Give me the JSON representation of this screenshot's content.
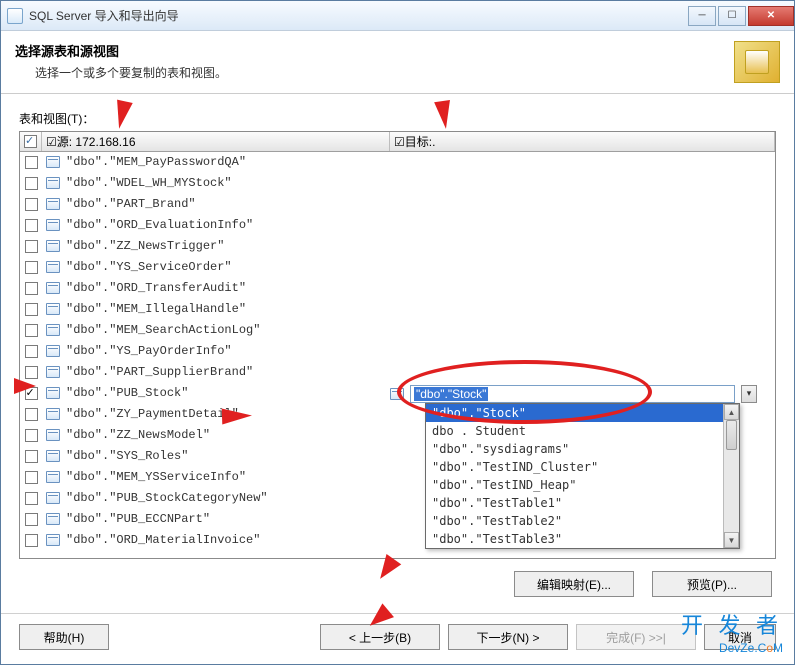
{
  "window": {
    "title": "SQL Server 导入和导出向导"
  },
  "header": {
    "title": "选择源表和源视图",
    "subtitle": "选择一个或多个要复制的表和视图。"
  },
  "label_tables": "表和视图(T)：",
  "columns": {
    "source_label": "源: 172.168.16",
    "dest_label": "目标:."
  },
  "rows": [
    {
      "text": "\"dbo\".\"MEM_PayPasswordQA\"",
      "checked": false
    },
    {
      "text": "\"dbo\".\"WDEL_WH_MYStock\"",
      "checked": false
    },
    {
      "text": "\"dbo\".\"PART_Brand\"",
      "checked": false
    },
    {
      "text": "\"dbo\".\"ORD_EvaluationInfo\"",
      "checked": false
    },
    {
      "text": "\"dbo\".\"ZZ_NewsTrigger\"",
      "checked": false
    },
    {
      "text": "\"dbo\".\"YS_ServiceOrder\"",
      "checked": false
    },
    {
      "text": "\"dbo\".\"ORD_TransferAudit\"",
      "checked": false
    },
    {
      "text": "\"dbo\".\"MEM_IllegalHandle\"",
      "checked": false
    },
    {
      "text": "\"dbo\".\"MEM_SearchActionLog\"",
      "checked": false
    },
    {
      "text": "\"dbo\".\"YS_PayOrderInfo\"",
      "checked": false
    },
    {
      "text": "\"dbo\".\"PART_SupplierBrand\"",
      "checked": false
    },
    {
      "text": "\"dbo\".\"PUB_Stock\"",
      "checked": true
    },
    {
      "text": "\"dbo\".\"ZY_PaymentDetail\"",
      "checked": false
    },
    {
      "text": "\"dbo\".\"ZZ_NewsModel\"",
      "checked": false
    },
    {
      "text": "\"dbo\".\"SYS_Roles\"",
      "checked": false
    },
    {
      "text": "\"dbo\".\"MEM_YSServiceInfo\"",
      "checked": false
    },
    {
      "text": "\"dbo\".\"PUB_StockCategoryNew\"",
      "checked": false
    },
    {
      "text": "\"dbo\".\"PUB_ECCNPart\"",
      "checked": false
    },
    {
      "text": "\"dbo\".\"ORD_MaterialInvoice\"",
      "checked": false
    }
  ],
  "dest_edit": {
    "value": "\"dbo\".\"Stock\""
  },
  "dropdown": {
    "options": [
      {
        "label": "\"dbo\".\"Stock\"",
        "selected": true
      },
      {
        "label": "dbo . Student",
        "selected": false
      },
      {
        "label": "\"dbo\".\"sysdiagrams\"",
        "selected": false
      },
      {
        "label": "\"dbo\".\"TestIND_Cluster\"",
        "selected": false
      },
      {
        "label": "\"dbo\".\"TestIND_Heap\"",
        "selected": false
      },
      {
        "label": "\"dbo\".\"TestTable1\"",
        "selected": false
      },
      {
        "label": "\"dbo\".\"TestTable2\"",
        "selected": false
      },
      {
        "label": "\"dbo\".\"TestTable3\"",
        "selected": false
      }
    ]
  },
  "buttons": {
    "edit_map": "编辑映射(E)...",
    "preview": "预览(P)...",
    "help": "帮助(H)",
    "back": "< 上一步(B)",
    "next": "下一步(N) >",
    "finish": "完成(F) >>|",
    "cancel": "取消"
  },
  "watermark": {
    "line1": "开 发 者",
    "line2a": "DevZe.C",
    "line2b": "o",
    "line2c": "M"
  }
}
